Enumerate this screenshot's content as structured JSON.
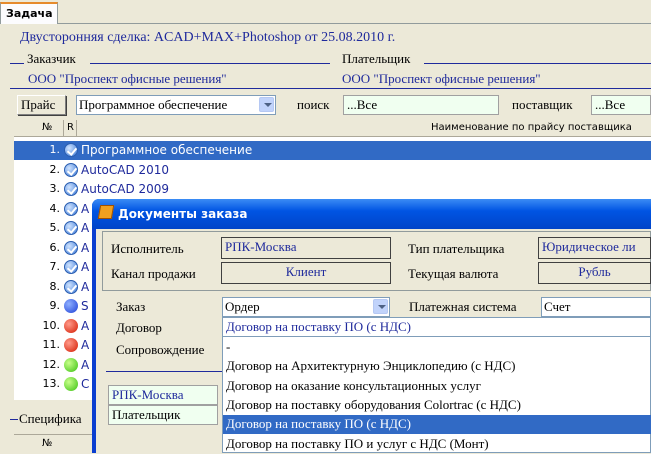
{
  "tab": {
    "label": "Задача"
  },
  "title": "Двусторонняя сделка: ACAD+MAX+Photoshop от 25.08.2010 г.",
  "customer": {
    "label": "Заказчик",
    "value": "ООО \"Проспект офисные решения\""
  },
  "payer": {
    "label": "Плательщик",
    "value": "ООО \"Проспект офисные решения\""
  },
  "filter": {
    "price_button": "Прайс",
    "category": "Программное обеспечение",
    "search_label": "поиск",
    "search_value": "...Все",
    "supplier_label": "поставщик",
    "supplier_value": "...Все"
  },
  "grid": {
    "col_num": "№",
    "col_r": "R",
    "col_name": "Наименование по прайсу поставщика",
    "rows": [
      {
        "num": "1.",
        "icon": "check-icon",
        "text": "Программное обеспечение",
        "selected": true
      },
      {
        "num": "2.",
        "icon": "check-icon",
        "text": "AutoCAD 2010"
      },
      {
        "num": "3.",
        "icon": "check-icon",
        "text": "AutoCAD 2009"
      },
      {
        "num": "4.",
        "icon": "check-icon",
        "text": "A"
      },
      {
        "num": "5.",
        "icon": "check-icon",
        "text": "A"
      },
      {
        "num": "6.",
        "icon": "check-icon",
        "text": "A"
      },
      {
        "num": "7.",
        "icon": "check-icon",
        "text": "A"
      },
      {
        "num": "8.",
        "icon": "check-icon",
        "text": "A"
      },
      {
        "num": "9.",
        "icon": "blue-circle-icon",
        "text": "S"
      },
      {
        "num": "10.",
        "icon": "red-circle-icon",
        "text": "A"
      },
      {
        "num": "11.",
        "icon": "red-circle-icon",
        "text": "A"
      },
      {
        "num": "12.",
        "icon": "green-circle-icon",
        "text": "A"
      },
      {
        "num": "13.",
        "icon": "green-circle-icon",
        "text": "C"
      }
    ]
  },
  "spec": {
    "label": "Специфика",
    "col_num": "№"
  },
  "dialog": {
    "title": "Документы заказа",
    "executor_label": "Исполнитель",
    "executor_value": "РПК-Москва",
    "payer_type_label": "Тип плательщика",
    "payer_type_value": "Юридическое ли",
    "channel_label": "Канал продажи",
    "channel_value": "Клиент",
    "currency_label": "Текущая валюта",
    "currency_value": "Рубль",
    "order_label": "Заказ",
    "order_value": "Ордер",
    "payment_system_label": "Платежная система",
    "payment_system_value": "Счет",
    "contract_label": "Договор",
    "contract_value": "Договор на поставку ПО (с НДС)",
    "support_label": "Сопровождение",
    "left_values": [
      "РПК-Москва",
      "Плательщик"
    ],
    "dropdown_items": [
      {
        "text": "-"
      },
      {
        "text": "Договор на Архитектурную Энциклопедию (с НДС)"
      },
      {
        "text": "Договор на оказание консультационных услуг"
      },
      {
        "text": "Договор на поставку оборудования Colortrac (с НДС)"
      },
      {
        "text": "Договор на поставку ПО (с НДС)",
        "selected": true
      },
      {
        "text": "Договор на поставку ПО и услуг с  НДС (Монт)"
      }
    ]
  },
  "colors": {
    "accent": "#1f2a9c",
    "selection": "#316ac5",
    "titlebar": "#0054e3"
  }
}
